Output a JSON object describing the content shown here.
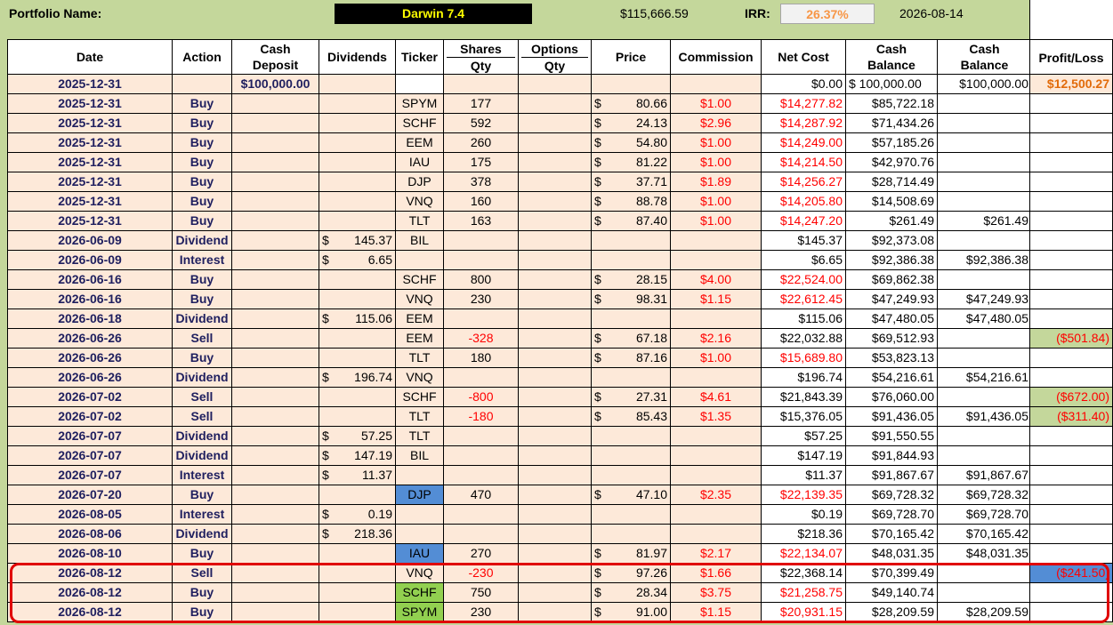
{
  "topbar": {
    "label": "Portfolio Name:",
    "name": "Darwin 7.4",
    "value": "$115,666.59",
    "irr_label": "IRR:",
    "irr": "26.37%",
    "date": "2026-08-14"
  },
  "headers": {
    "date": "Date",
    "action": "Action",
    "cash_deposit_1": "Cash",
    "cash_deposit_2": "Deposit",
    "dividends": "Dividends",
    "ticker": "Ticker",
    "shares_1": "Shares",
    "shares_2": "Qty",
    "options_1": "Options",
    "options_2": "Qty",
    "price": "Price",
    "commission": "Commission",
    "net_cost": "Net Cost",
    "cash_bal_a_1": "Cash",
    "cash_bal_a_2": "Balance",
    "cash_bal_b_1": "Cash",
    "cash_bal_b_2": "Balance",
    "profit_loss": "Profit/Loss"
  },
  "colors": {
    "ticker_blue": "#538dd5",
    "ticker_green": "#92d050",
    "highlight_border": "#e00000"
  },
  "rows": [
    {
      "date": "2025-12-31",
      "action": "",
      "deposit": "$100,000.00",
      "div": "",
      "ticker": "",
      "shares": "",
      "price": "",
      "comm": "",
      "net": "$0.00",
      "cb1": "$  100,000.00",
      "cb2": "$100,000.00",
      "pl": "$12,500.27"
    },
    {
      "date": "2025-12-31",
      "action": "Buy",
      "deposit": "",
      "div": "",
      "ticker": "SPYM",
      "shares": "177",
      "price": "80.66",
      "comm": "$1.00",
      "net": "$14,277.82",
      "cb1": "$85,722.18",
      "cb2": "",
      "pl": ""
    },
    {
      "date": "2025-12-31",
      "action": "Buy",
      "deposit": "",
      "div": "",
      "ticker": "SCHF",
      "shares": "592",
      "price": "24.13",
      "comm": "$2.96",
      "net": "$14,287.92",
      "cb1": "$71,434.26",
      "cb2": "",
      "pl": ""
    },
    {
      "date": "2025-12-31",
      "action": "Buy",
      "deposit": "",
      "div": "",
      "ticker": "EEM",
      "shares": "260",
      "price": "54.80",
      "comm": "$1.00",
      "net": "$14,249.00",
      "cb1": "$57,185.26",
      "cb2": "",
      "pl": ""
    },
    {
      "date": "2025-12-31",
      "action": "Buy",
      "deposit": "",
      "div": "",
      "ticker": "IAU",
      "shares": "175",
      "price": "81.22",
      "comm": "$1.00",
      "net": "$14,214.50",
      "cb1": "$42,970.76",
      "cb2": "",
      "pl": ""
    },
    {
      "date": "2025-12-31",
      "action": "Buy",
      "deposit": "",
      "div": "",
      "ticker": "DJP",
      "shares": "378",
      "price": "37.71",
      "comm": "$1.89",
      "net": "$14,256.27",
      "cb1": "$28,714.49",
      "cb2": "",
      "pl": ""
    },
    {
      "date": "2025-12-31",
      "action": "Buy",
      "deposit": "",
      "div": "",
      "ticker": "VNQ",
      "shares": "160",
      "price": "88.78",
      "comm": "$1.00",
      "net": "$14,205.80",
      "cb1": "$14,508.69",
      "cb2": "",
      "pl": ""
    },
    {
      "date": "2025-12-31",
      "action": "Buy",
      "deposit": "",
      "div": "",
      "ticker": "TLT",
      "shares": "163",
      "price": "87.40",
      "comm": "$1.00",
      "net": "$14,247.20",
      "cb1": "$261.49",
      "cb2": "$261.49",
      "pl": ""
    },
    {
      "date": "2026-06-09",
      "action": "Dividend",
      "deposit": "",
      "div": "145.37",
      "ticker": "BIL",
      "shares": "",
      "price": "",
      "comm": "",
      "net": "$145.37",
      "cb1": "$92,373.08",
      "cb2": "",
      "pl": ""
    },
    {
      "date": "2026-06-09",
      "action": "Interest",
      "deposit": "",
      "div": "6.65",
      "ticker": "",
      "shares": "",
      "price": "",
      "comm": "",
      "net": "$6.65",
      "cb1": "$92,386.38",
      "cb2": "$92,386.38",
      "pl": ""
    },
    {
      "date": "2026-06-16",
      "action": "Buy",
      "deposit": "",
      "div": "",
      "ticker": "SCHF",
      "shares": "800",
      "price": "28.15",
      "comm": "$4.00",
      "net": "$22,524.00",
      "cb1": "$69,862.38",
      "cb2": "",
      "pl": ""
    },
    {
      "date": "2026-06-16",
      "action": "Buy",
      "deposit": "",
      "div": "",
      "ticker": "VNQ",
      "shares": "230",
      "price": "98.31",
      "comm": "$1.15",
      "net": "$22,612.45",
      "cb1": "$47,249.93",
      "cb2": "$47,249.93",
      "pl": ""
    },
    {
      "date": "2026-06-18",
      "action": "Dividend",
      "deposit": "",
      "div": "115.06",
      "ticker": "EEM",
      "shares": "",
      "price": "",
      "comm": "",
      "net": "$115.06",
      "cb1": "$47,480.05",
      "cb2": "$47,480.05",
      "pl": ""
    },
    {
      "date": "2026-06-26",
      "action": "Sell",
      "deposit": "",
      "div": "",
      "ticker": "EEM",
      "shares": "-328",
      "price": "67.18",
      "comm": "$2.16",
      "net": "$22,032.88",
      "cb1": "$69,512.93",
      "cb2": "",
      "pl": "($501.84)"
    },
    {
      "date": "2026-06-26",
      "action": "Buy",
      "deposit": "",
      "div": "",
      "ticker": "TLT",
      "shares": "180",
      "price": "87.16",
      "comm": "$1.00",
      "net": "$15,689.80",
      "cb1": "$53,823.13",
      "cb2": "",
      "pl": ""
    },
    {
      "date": "2026-06-26",
      "action": "Dividend",
      "deposit": "",
      "div": "196.74",
      "ticker": "VNQ",
      "shares": "",
      "price": "",
      "comm": "",
      "net": "$196.74",
      "cb1": "$54,216.61",
      "cb2": "$54,216.61",
      "pl": ""
    },
    {
      "date": "2026-07-02",
      "action": "Sell",
      "deposit": "",
      "div": "",
      "ticker": "SCHF",
      "shares": "-800",
      "price": "27.31",
      "comm": "$4.61",
      "net": "$21,843.39",
      "cb1": "$76,060.00",
      "cb2": "",
      "pl": "($672.00)"
    },
    {
      "date": "2026-07-02",
      "action": "Sell",
      "deposit": "",
      "div": "",
      "ticker": "TLT",
      "shares": "-180",
      "price": "85.43",
      "comm": "$1.35",
      "net": "$15,376.05",
      "cb1": "$91,436.05",
      "cb2": "$91,436.05",
      "pl": "($311.40)"
    },
    {
      "date": "2026-07-07",
      "action": "Dividend",
      "deposit": "",
      "div": "57.25",
      "ticker": "TLT",
      "shares": "",
      "price": "",
      "comm": "",
      "net": "$57.25",
      "cb1": "$91,550.55",
      "cb2": "",
      "pl": ""
    },
    {
      "date": "2026-07-07",
      "action": "Dividend",
      "deposit": "",
      "div": "147.19",
      "ticker": "BIL",
      "shares": "",
      "price": "",
      "comm": "",
      "net": "$147.19",
      "cb1": "$91,844.93",
      "cb2": "",
      "pl": ""
    },
    {
      "date": "2026-07-07",
      "action": "Interest",
      "deposit": "",
      "div": "11.37",
      "ticker": "",
      "shares": "",
      "price": "",
      "comm": "",
      "net": "$11.37",
      "cb1": "$91,867.67",
      "cb2": "$91,867.67",
      "pl": ""
    },
    {
      "date": "2026-07-20",
      "action": "Buy",
      "deposit": "",
      "div": "",
      "ticker": "DJP",
      "shares": "470",
      "price": "47.10",
      "comm": "$2.35",
      "net": "$22,139.35",
      "cb1": "$69,728.32",
      "cb2": "$69,728.32",
      "pl": ""
    },
    {
      "date": "2026-08-05",
      "action": "Interest",
      "deposit": "",
      "div": "0.19",
      "ticker": "",
      "shares": "",
      "price": "",
      "comm": "",
      "net": "$0.19",
      "cb1": "$69,728.70",
      "cb2": "$69,728.70",
      "pl": ""
    },
    {
      "date": "2026-08-06",
      "action": "Dividend",
      "deposit": "",
      "div": "218.36",
      "ticker": "",
      "shares": "",
      "price": "",
      "comm": "",
      "net": "$218.36",
      "cb1": "$70,165.42",
      "cb2": "$70,165.42",
      "pl": ""
    },
    {
      "date": "2026-08-10",
      "action": "Buy",
      "deposit": "",
      "div": "",
      "ticker": "IAU",
      "shares": "270",
      "price": "81.97",
      "comm": "$2.17",
      "net": "$22,134.07",
      "cb1": "$48,031.35",
      "cb2": "$48,031.35",
      "pl": ""
    },
    {
      "date": "2026-08-12",
      "action": "Sell",
      "deposit": "",
      "div": "",
      "ticker": "VNQ",
      "shares": "-230",
      "price": "97.26",
      "comm": "$1.66",
      "net": "$22,368.14",
      "cb1": "$70,399.49",
      "cb2": "",
      "pl": "($241.50)"
    },
    {
      "date": "2026-08-12",
      "action": "Buy",
      "deposit": "",
      "div": "",
      "ticker": "SCHF",
      "shares": "750",
      "price": "28.34",
      "comm": "$3.75",
      "net": "$21,258.75",
      "cb1": "$49,140.74",
      "cb2": "",
      "pl": ""
    },
    {
      "date": "2026-08-12",
      "action": "Buy",
      "deposit": "",
      "div": "",
      "ticker": "SPYM",
      "shares": "230",
      "price": "91.00",
      "comm": "$1.15",
      "net": "$20,931.15",
      "cb1": "$28,209.59",
      "cb2": "$28,209.59",
      "pl": ""
    }
  ]
}
